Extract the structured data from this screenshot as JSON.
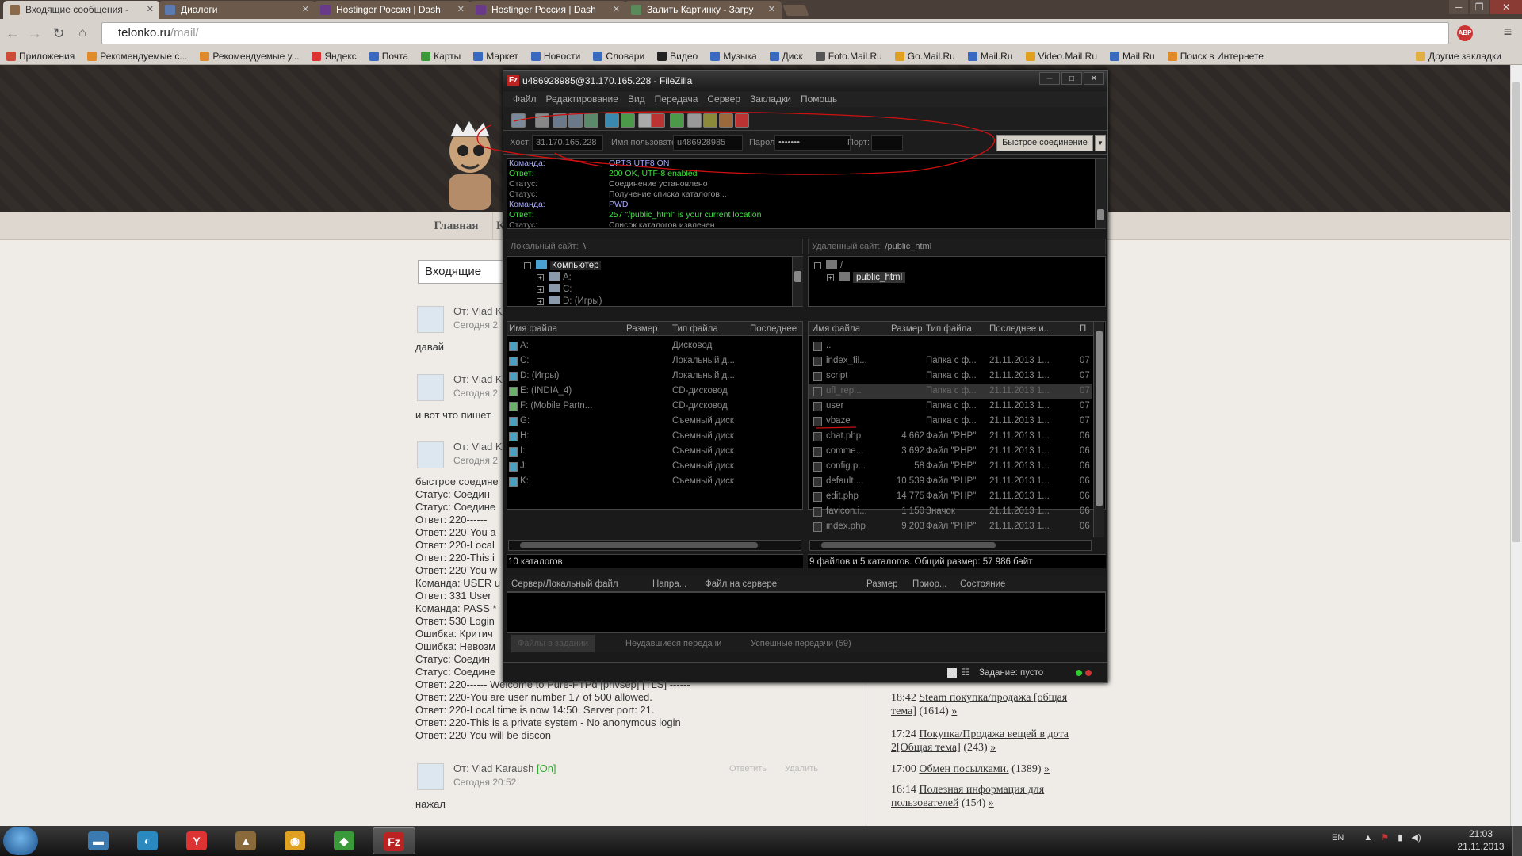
{
  "browser": {
    "tabs": [
      {
        "label": "Входящие сообщения -",
        "color": "#8a6a4a"
      },
      {
        "label": "Диалоги",
        "color": "#5a7ab0"
      },
      {
        "label": "Hostinger Россия | Dash",
        "color": "#6a3a8a"
      },
      {
        "label": "Hostinger Россия | Dash",
        "color": "#6a3a8a"
      },
      {
        "label": "Залить Картинку - Загру",
        "color": "#5a8a5a"
      }
    ],
    "url_host": "telonko.ru",
    "url_path": "/mail/",
    "abp_label": "ABP",
    "bookmarks": [
      {
        "label": "Приложения",
        "color": "#d04a3a"
      },
      {
        "label": "Рекомендуемые с...",
        "color": "#e08a2a"
      },
      {
        "label": "Рекомендуемые у...",
        "color": "#e08a2a"
      },
      {
        "label": "Яндекс",
        "color": "#d33"
      },
      {
        "label": "Почта",
        "color": "#3a6ac0"
      },
      {
        "label": "Карты",
        "color": "#3a9a3a"
      },
      {
        "label": "Маркет",
        "color": "#3a6ac0"
      },
      {
        "label": "Новости",
        "color": "#3a6ac0"
      },
      {
        "label": "Словари",
        "color": "#3a6ac0"
      },
      {
        "label": "Видео",
        "color": "#222"
      },
      {
        "label": "Музыка",
        "color": "#3a6ac0"
      },
      {
        "label": "Диск",
        "color": "#3a6ac0"
      },
      {
        "label": "Foto.Mail.Ru",
        "color": "#555"
      },
      {
        "label": "Go.Mail.Ru",
        "color": "#e0a020"
      },
      {
        "label": "Mail.Ru",
        "color": "#3a6ac0"
      },
      {
        "label": "Video.Mail.Ru",
        "color": "#e0a020"
      },
      {
        "label": "Mail.Ru",
        "color": "#3a6ac0"
      },
      {
        "label": "Поиск в Интернете",
        "color": "#e08a2a"
      }
    ],
    "other_bookmarks": "Другие закладки"
  },
  "site": {
    "nav_home": "Главная",
    "nav_next": "К",
    "inbox_label": "Входящие",
    "messages": [
      {
        "from": "От: Vlad K",
        "date": "Сегодня 2",
        "body": "давай"
      },
      {
        "from": "От: Vlad K",
        "date": "Сегодня 2",
        "body": "и вот что пишет"
      },
      {
        "from": "От: Vlad K",
        "date": "Сегодня 2",
        "body": ""
      }
    ],
    "log_lines_partial": [
      "быстрое соедине",
      "Статус: Соедин",
      "Статус: Соедине",
      "Ответ: 220------",
      "Ответ: 220-You a",
      "Ответ: 220-Local",
      "Ответ: 220-This i",
      "Ответ: 220 You w",
      "Команда: USER u",
      "Ответ: 331 User",
      "Команда: PASS *",
      "Ответ: 530 Login",
      "Ошибка: Критич",
      "Ошибка: Невозм",
      "Статус: Соедин",
      "Статус: Соедине"
    ],
    "log_lines_full": [
      "Ответ: 220------ Welcome to Pure-FTPd [privsep] [TLS] ------",
      "Ответ: 220-You are user number 17 of 500 allowed.",
      "Ответ: 220-Local time is now 14:50. Server port: 21.",
      "Ответ: 220-This is a private system - No anonymous login",
      "Ответ: 220 You will be discon"
    ],
    "last_message": {
      "from": "От: Vlad Karaush",
      "status": "[On]",
      "date": "Сегодня 20:52",
      "body": "нажал",
      "reply": "Ответить",
      "delete": "Удалить"
    },
    "sidebar_topics": [
      {
        "time": "18:42",
        "title": "Steam покупка/продажа [общая тема]",
        "count": "(1614)",
        "arrow": "»"
      },
      {
        "time": "17:24",
        "title": "Покупка/Продажа вещей в дота 2[Общая тема]",
        "count": "(243)",
        "arrow": "»"
      },
      {
        "time": "17:00",
        "title": "Обмен посылками.",
        "count": "(1389)",
        "arrow": "»"
      },
      {
        "time": "16:14",
        "title": "Полезная информация для пользователей",
        "count": "(154)",
        "arrow": "»"
      }
    ]
  },
  "filezilla": {
    "title": "u486928985@31.170.165.228 - FileZilla",
    "menu": [
      "Файл",
      "Редактирование",
      "Вид",
      "Передача",
      "Сервер",
      "Закладки",
      "Помощь"
    ],
    "quickconnect": {
      "host_label": "Хост:",
      "host_value": "31.170.165.228",
      "user_label": "Имя пользователя",
      "user_value": "u486928985",
      "pass_label": "Пароль:",
      "pass_value": "•••••••",
      "port_label": "Порт:",
      "port_value": "",
      "button": "Быстрое соединение"
    },
    "log": [
      {
        "k": "Команда:",
        "v": "OPTS UTF8 ON",
        "color": "#a8a8ff"
      },
      {
        "k": "Ответ:",
        "v": "200 OK, UTF-8 enabled",
        "color": "#3fe03f"
      },
      {
        "k": "Статус:",
        "v": "Соединение установлено",
        "color": "#999"
      },
      {
        "k": "Статус:",
        "v": "Получение списка каталогов...",
        "color": "#999"
      },
      {
        "k": "Команда:",
        "v": "PWD",
        "color": "#a8a8ff"
      },
      {
        "k": "Ответ:",
        "v": "257 \"/public_html\" is your current location",
        "color": "#3fe03f"
      },
      {
        "k": "Статус:",
        "v": "Список каталогов извлечен",
        "color": "#999"
      }
    ],
    "local_site_label": "Локальный сайт:",
    "local_site_path": "\\",
    "remote_site_label": "Удаленный сайт:",
    "remote_site_path": "/public_html",
    "local_tree": [
      {
        "label": "Компьютер",
        "sel": true
      },
      {
        "label": "A:"
      },
      {
        "label": "C:"
      },
      {
        "label": "D: (Игры)"
      }
    ],
    "remote_tree": [
      {
        "label": "/"
      },
      {
        "label": "public_html",
        "sel": true
      }
    ],
    "local_cols": [
      "Имя файла",
      "Размер",
      "Тип файла",
      "Последнее"
    ],
    "remote_cols": [
      "Имя файла",
      "Размер",
      "Тип файла",
      "Последнее и...",
      "П"
    ],
    "local_files": [
      {
        "name": "A:",
        "size": "",
        "type": "Дисковод"
      },
      {
        "name": "C:",
        "size": "",
        "type": "Локальный д..."
      },
      {
        "name": "D: (Игры)",
        "size": "",
        "type": "Локальный д..."
      },
      {
        "name": "E: (INDIA_4)",
        "size": "",
        "type": "CD-дисковод"
      },
      {
        "name": "F: (Mobile Partn...",
        "size": "",
        "type": "CD-дисковод"
      },
      {
        "name": "G:",
        "size": "",
        "type": "Съемный диск"
      },
      {
        "name": "H:",
        "size": "",
        "type": "Съемный диск"
      },
      {
        "name": "I:",
        "size": "",
        "type": "Съемный диск"
      },
      {
        "name": "J:",
        "size": "",
        "type": "Съемный диск"
      },
      {
        "name": "K:",
        "size": "",
        "type": "Съемный диск"
      }
    ],
    "remote_files": [
      {
        "name": "..",
        "size": "",
        "type": "",
        "date": "",
        "p": ""
      },
      {
        "name": "index_fil...",
        "size": "",
        "type": "Папка с ф...",
        "date": "21.11.2013 1...",
        "p": "07"
      },
      {
        "name": "script",
        "size": "",
        "type": "Папка с ф...",
        "date": "21.11.2013 1...",
        "p": "07"
      },
      {
        "name": "ufl_rep...",
        "size": "",
        "type": "Папка с ф...",
        "date": "21.11.2013 1...",
        "p": "07",
        "sel": true
      },
      {
        "name": "user",
        "size": "",
        "type": "Папка с ф...",
        "date": "21.11.2013 1...",
        "p": "07"
      },
      {
        "name": "vbaze",
        "size": "",
        "type": "Папка с ф...",
        "date": "21.11.2013 1...",
        "p": "07"
      },
      {
        "name": "chat.php",
        "size": "4 662",
        "type": "Файл \"PHP\"",
        "date": "21.11.2013 1...",
        "p": "06"
      },
      {
        "name": "comme...",
        "size": "3 692",
        "type": "Файл \"PHP\"",
        "date": "21.11.2013 1...",
        "p": "06"
      },
      {
        "name": "config.p...",
        "size": "58",
        "type": "Файл \"PHP\"",
        "date": "21.11.2013 1...",
        "p": "06"
      },
      {
        "name": "default....",
        "size": "10 539",
        "type": "Файл \"PHP\"",
        "date": "21.11.2013 1...",
        "p": "06"
      },
      {
        "name": "edit.php",
        "size": "14 775",
        "type": "Файл \"PHP\"",
        "date": "21.11.2013 1...",
        "p": "06"
      },
      {
        "name": "favicon.i...",
        "size": "1 150",
        "type": "Значок",
        "date": "21.11.2013 1...",
        "p": "06"
      },
      {
        "name": "index.php",
        "size": "9 203",
        "type": "Файл \"PHP\"",
        "date": "21.11.2013 1...",
        "p": "06"
      }
    ],
    "local_status": "10 каталогов",
    "remote_status": "9 файлов и 5 каталогов. Общий размер: 57 986 байт",
    "queue_cols": [
      "Сервер/Локальный файл",
      "Напра...",
      "Файл на сервере",
      "Размер",
      "Приор...",
      "Состояние"
    ],
    "queue_tabs": [
      "Файлы в задании",
      "Неудавшиеся передачи",
      "Успешные передачи (59)"
    ],
    "status_text": "Задание: пусто"
  },
  "taskbar": {
    "apps": [
      {
        "name": "app-1",
        "glyph": "▬",
        "color": "#3a7ab0"
      },
      {
        "name": "app-2",
        "glyph": "◐",
        "color": "#2a8ac0"
      },
      {
        "name": "yandex-browser",
        "glyph": "Y",
        "color": "#d33"
      },
      {
        "name": "app-4",
        "glyph": "▲",
        "color": "#8a6a3a"
      },
      {
        "name": "chrome",
        "glyph": "◉",
        "color": "#e0a020"
      },
      {
        "name": "app-6",
        "glyph": "◆",
        "color": "#3a9a3a"
      },
      {
        "name": "filezilla",
        "glyph": "Fz",
        "color": "#b22",
        "active": true
      }
    ],
    "lang": "EN",
    "time": "21:03",
    "date": "21.11.2013"
  }
}
